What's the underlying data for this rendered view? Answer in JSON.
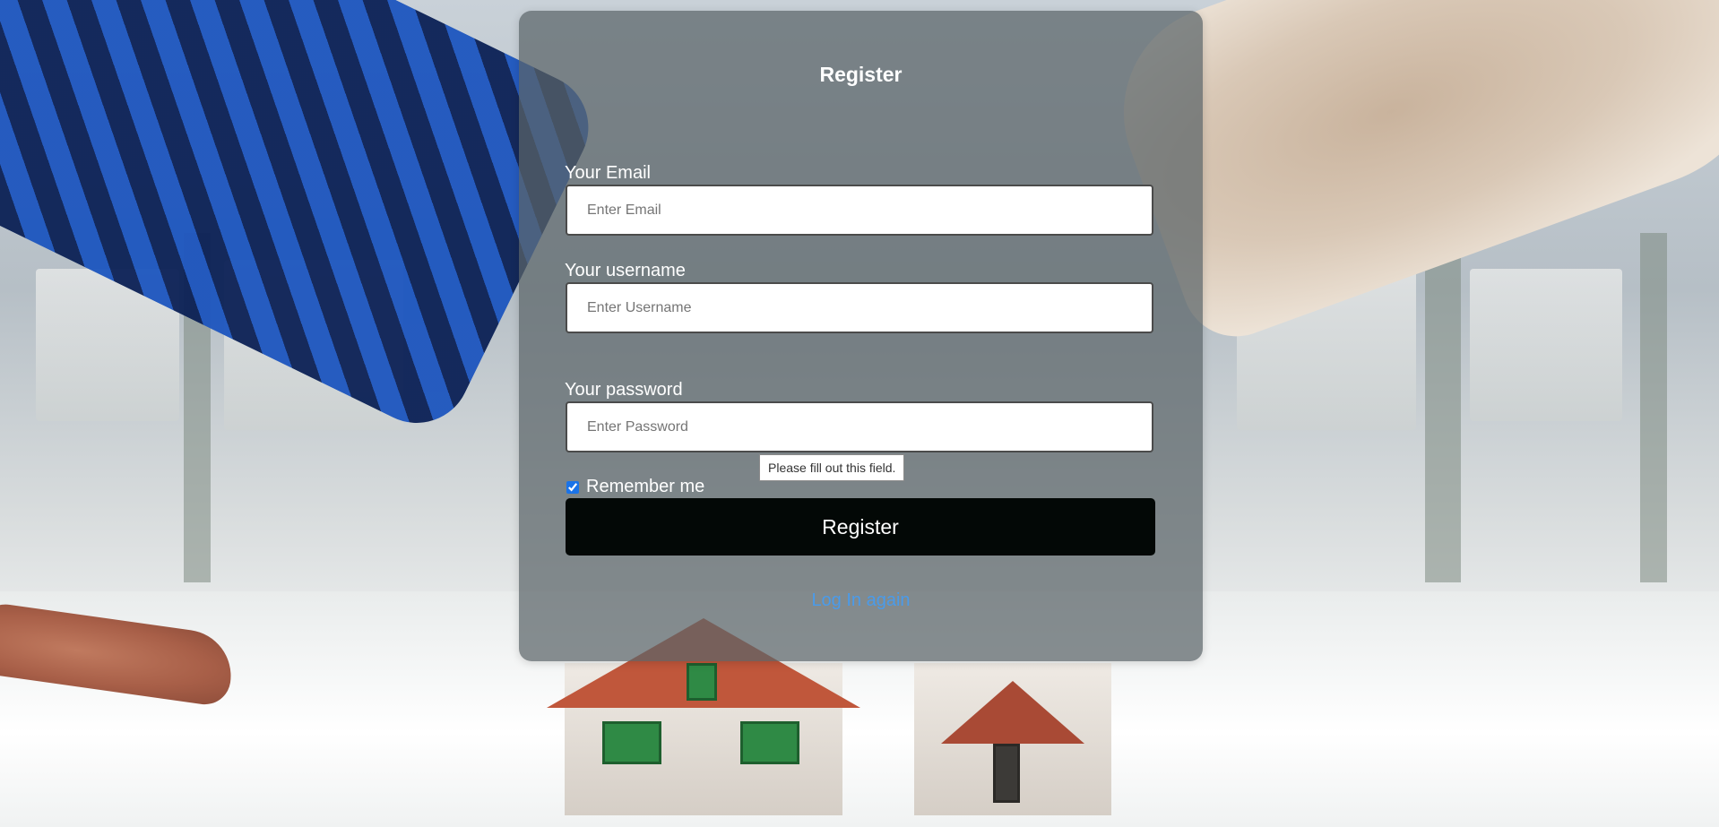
{
  "form": {
    "title": "Register",
    "email_label": "Your Email",
    "email_placeholder": "Enter Email",
    "email_value": "",
    "username_label": "Your username",
    "username_placeholder": "Enter Username",
    "username_value": "",
    "password_label": "Your password",
    "password_placeholder": "Enter Password",
    "password_value": "",
    "remember_label": "Remember me",
    "remember_checked": true,
    "register_button": "Register",
    "login_link": "Log In again"
  },
  "validation_tooltip": "Please fill out this field.",
  "colors": {
    "card_overlay": "#5a6468",
    "button_bg": "#030806",
    "link": "#4a9bea",
    "checkbox_accent": "#1a73e8"
  }
}
